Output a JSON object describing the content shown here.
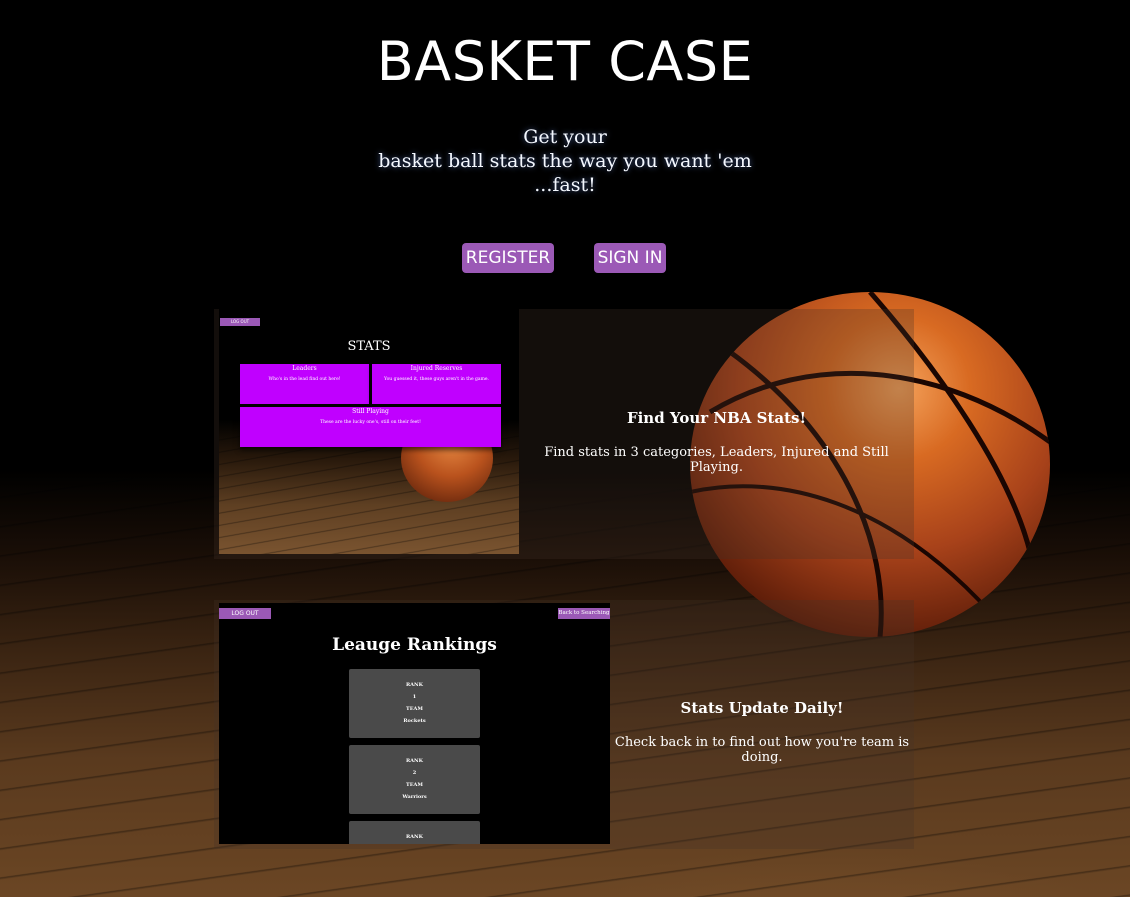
{
  "header": {
    "title": "BASKET CASE",
    "tagline_lines": [
      "Get your",
      "basket ball stats the way you want 'em",
      "...fast!"
    ]
  },
  "buttons": {
    "register": "REGISTER",
    "signin": "SIGN IN"
  },
  "features": [
    {
      "heading": "Find Your NBA Stats!",
      "text": "Find stats in 3 categories, Leaders, Injured and Still Playing."
    },
    {
      "heading": "Stats Update Daily!",
      "text": "Check back in to find out how you're team is doing."
    }
  ],
  "preview_stats": {
    "logout": "LOG OUT",
    "title": "STATS",
    "boxes": [
      {
        "title": "Leaders",
        "text": "Who's in the lead find out here!"
      },
      {
        "title": "Injured Reserves",
        "text": "You guessed it, these guys aren't in the game."
      },
      {
        "title": "Still Playing",
        "text": "These are the lucky one's, still on their feet!"
      }
    ]
  },
  "preview_rankings": {
    "logout": "LOG OUT",
    "back": "Back to Searching",
    "title": "Leauge Rankings",
    "cards": [
      {
        "rank_label": "RANK",
        "rank": "1",
        "team_label": "TEAM",
        "team": "Rockets"
      },
      {
        "rank_label": "RANK",
        "rank": "2",
        "team_label": "TEAM",
        "team": "Warriors"
      },
      {
        "rank_label": "RANK"
      }
    ]
  },
  "colors": {
    "accent": "#9b59b6",
    "stat_box": "#c000ff",
    "card": "#4a4a4a"
  }
}
